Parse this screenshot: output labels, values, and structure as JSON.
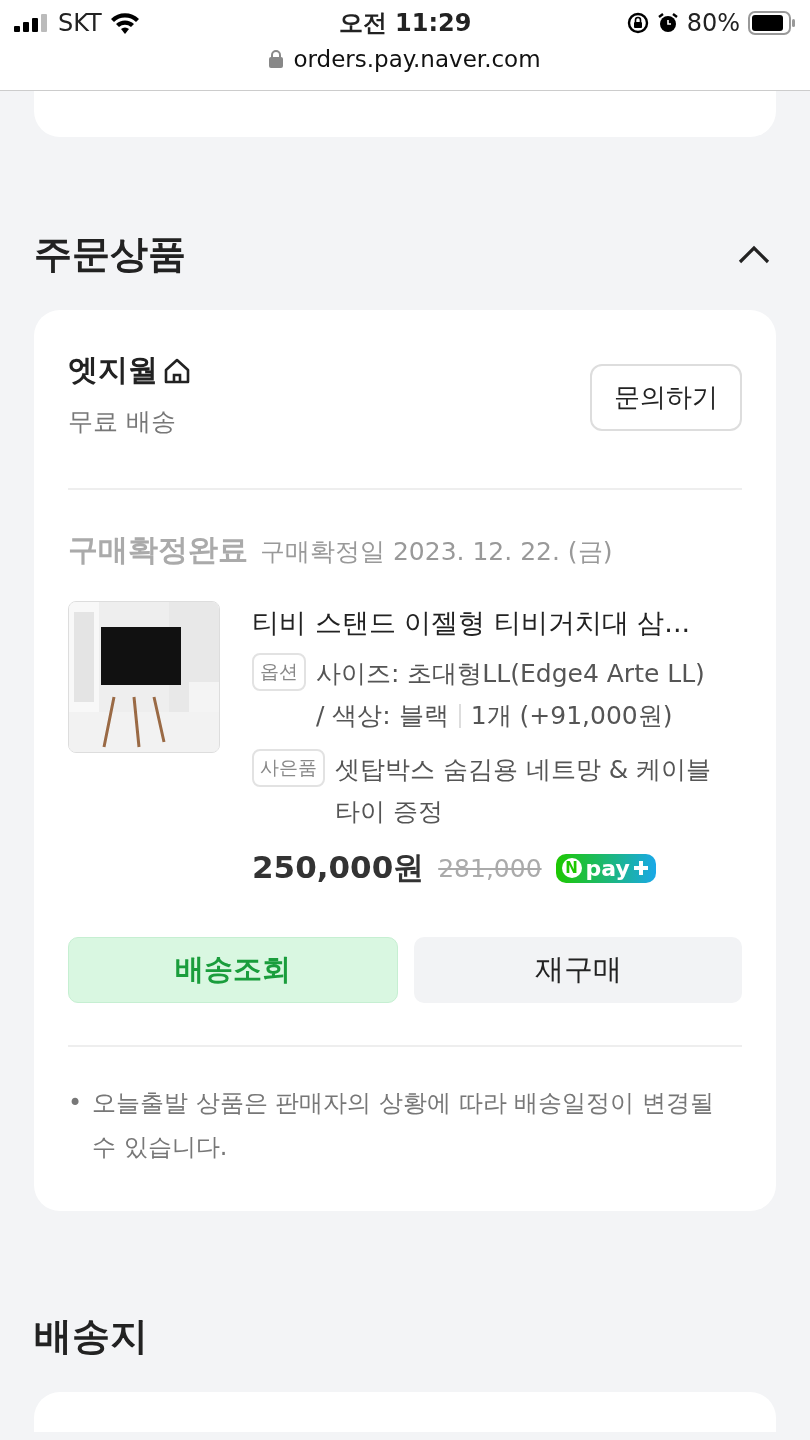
{
  "status_bar": {
    "carrier": "SKT",
    "time": "오전 11:29",
    "battery": "80%"
  },
  "url_bar": {
    "url": "orders.pay.naver.com"
  },
  "order_section": {
    "title": "주문상품",
    "expanded": true
  },
  "store": {
    "name": "엣지월",
    "shipping": "무료 배송",
    "inquiry_button": "문의하기"
  },
  "order": {
    "status": "구매확정완료",
    "confirm_date": "구매확정일 2023. 12. 22. (금)",
    "product_name": "티비 스탠드 이젤형 티비거치대 삼...",
    "options": [
      {
        "tag": "옵션",
        "lines": [
          "사이즈: 초대형LL(Edge4 Arte LL)",
          "/ 색상: 블랙"
        ],
        "quantity": "1개 (+91,000원)"
      },
      {
        "tag": "사은품",
        "lines": [
          "셋탑박스 숨김용 네트망 & 케이블",
          "타이 증정"
        ]
      }
    ],
    "price": "250,000원",
    "original_price": "281,000",
    "npay_badge": {
      "mark": "N",
      "label": "pay"
    }
  },
  "buttons": [
    {
      "label": "배송조회",
      "kind": "primary"
    },
    {
      "label": "재구매",
      "kind": "secondary"
    }
  ],
  "notice": {
    "bullet": "•",
    "text": "오늘출발 상품은 판매자의 상황에 따라 배송일정이 변경될 수 있습니다."
  },
  "delivery_section": {
    "title": "배송지"
  }
}
